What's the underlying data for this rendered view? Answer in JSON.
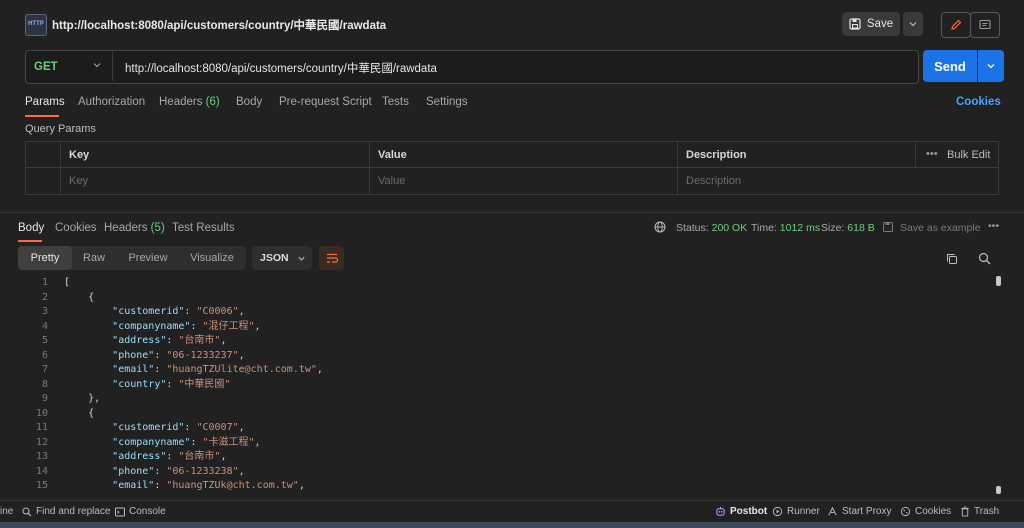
{
  "request": {
    "title": "http://localhost:8080/api/customers/country/中華民國/rawdata",
    "method": "GET",
    "url": "http://localhost:8080/api/customers/country/中華民國/rawdata",
    "save_label": "Save",
    "send_label": "Send",
    "icon_text": "HTTP"
  },
  "request_tabs": {
    "params": "Params",
    "authorization": "Authorization",
    "headers": "Headers",
    "headers_count": "(6)",
    "body": "Body",
    "prerequest": "Pre-request Script",
    "tests": "Tests",
    "settings": "Settings",
    "cookies": "Cookies"
  },
  "query_params": {
    "title": "Query Params",
    "col_key": "Key",
    "col_value": "Value",
    "col_description": "Description",
    "bulk_edit": "Bulk Edit",
    "placeholder_key": "Key",
    "placeholder_value": "Value",
    "placeholder_description": "Description"
  },
  "response_tabs": {
    "body": "Body",
    "cookies": "Cookies",
    "headers": "Headers",
    "headers_count": "(5)",
    "test_results": "Test Results"
  },
  "response_status": {
    "status_label": "Status:",
    "status_value": "200 OK",
    "time_label": "Time:",
    "time_value": "1012 ms",
    "size_label": "Size:",
    "size_value": "618 B",
    "save_example": "Save as example"
  },
  "view_modes": {
    "pretty": "Pretty",
    "raw": "Raw",
    "preview": "Preview",
    "visualize": "Visualize",
    "format": "JSON"
  },
  "code_lines": [
    {
      "n": "1",
      "indent": "",
      "parts": [
        {
          "t": "[",
          "c": "p"
        }
      ]
    },
    {
      "n": "2",
      "indent": "    ",
      "parts": [
        {
          "t": "{",
          "c": "p"
        }
      ]
    },
    {
      "n": "3",
      "indent": "        ",
      "parts": [
        {
          "t": "\"customerid\"",
          "c": "k"
        },
        {
          "t": ": ",
          "c": "p"
        },
        {
          "t": "\"C0006\"",
          "c": "s"
        },
        {
          "t": ",",
          "c": "p"
        }
      ]
    },
    {
      "n": "4",
      "indent": "        ",
      "parts": [
        {
          "t": "\"companyname\"",
          "c": "k"
        },
        {
          "t": ": ",
          "c": "p"
        },
        {
          "t": "\"混仔工程\"",
          "c": "s"
        },
        {
          "t": ",",
          "c": "p"
        }
      ]
    },
    {
      "n": "5",
      "indent": "        ",
      "parts": [
        {
          "t": "\"address\"",
          "c": "k"
        },
        {
          "t": ": ",
          "c": "p"
        },
        {
          "t": "\"台南市\"",
          "c": "s"
        },
        {
          "t": ",",
          "c": "p"
        }
      ]
    },
    {
      "n": "6",
      "indent": "        ",
      "parts": [
        {
          "t": "\"phone\"",
          "c": "k"
        },
        {
          "t": ": ",
          "c": "p"
        },
        {
          "t": "\"06-1233237\"",
          "c": "s"
        },
        {
          "t": ",",
          "c": "p"
        }
      ]
    },
    {
      "n": "7",
      "indent": "        ",
      "parts": [
        {
          "t": "\"email\"",
          "c": "k"
        },
        {
          "t": ": ",
          "c": "p"
        },
        {
          "t": "\"huangTZUlite@cht.com.tw\"",
          "c": "s"
        },
        {
          "t": ",",
          "c": "p"
        }
      ]
    },
    {
      "n": "8",
      "indent": "        ",
      "parts": [
        {
          "t": "\"country\"",
          "c": "k"
        },
        {
          "t": ": ",
          "c": "p"
        },
        {
          "t": "\"中華民國\"",
          "c": "s"
        }
      ]
    },
    {
      "n": "9",
      "indent": "    ",
      "parts": [
        {
          "t": "},",
          "c": "p"
        }
      ]
    },
    {
      "n": "10",
      "indent": "    ",
      "parts": [
        {
          "t": "{",
          "c": "p"
        }
      ]
    },
    {
      "n": "11",
      "indent": "        ",
      "parts": [
        {
          "t": "\"customerid\"",
          "c": "k"
        },
        {
          "t": ": ",
          "c": "p"
        },
        {
          "t": "\"C0007\"",
          "c": "s"
        },
        {
          "t": ",",
          "c": "p"
        }
      ]
    },
    {
      "n": "12",
      "indent": "        ",
      "parts": [
        {
          "t": "\"companyname\"",
          "c": "k"
        },
        {
          "t": ": ",
          "c": "p"
        },
        {
          "t": "\"卡滋工程\"",
          "c": "s"
        },
        {
          "t": ",",
          "c": "p"
        }
      ]
    },
    {
      "n": "13",
      "indent": "        ",
      "parts": [
        {
          "t": "\"address\"",
          "c": "k"
        },
        {
          "t": ": ",
          "c": "p"
        },
        {
          "t": "\"台南市\"",
          "c": "s"
        },
        {
          "t": ",",
          "c": "p"
        }
      ]
    },
    {
      "n": "14",
      "indent": "        ",
      "parts": [
        {
          "t": "\"phone\"",
          "c": "k"
        },
        {
          "t": ": ",
          "c": "p"
        },
        {
          "t": "\"06-1233238\"",
          "c": "s"
        },
        {
          "t": ",",
          "c": "p"
        }
      ]
    },
    {
      "n": "15",
      "indent": "        ",
      "parts": [
        {
          "t": "\"email\"",
          "c": "k"
        },
        {
          "t": ": ",
          "c": "p"
        },
        {
          "t": "\"huangTZUk@cht.com.tw\"",
          "c": "s"
        },
        {
          "t": ",",
          "c": "p"
        }
      ]
    }
  ],
  "footer": {
    "online": "ine",
    "find_replace": "Find and replace",
    "console": "Console",
    "postbot": "Postbot",
    "runner": "Runner",
    "start_proxy": "Start Proxy",
    "cookies": "Cookies",
    "trash": "Trash"
  },
  "colors": {
    "accent": "#ff6c37",
    "send": "#1a74e8",
    "method_get": "#6bcf7f",
    "json_key": "#9cdcfe",
    "json_string": "#ce9178"
  }
}
